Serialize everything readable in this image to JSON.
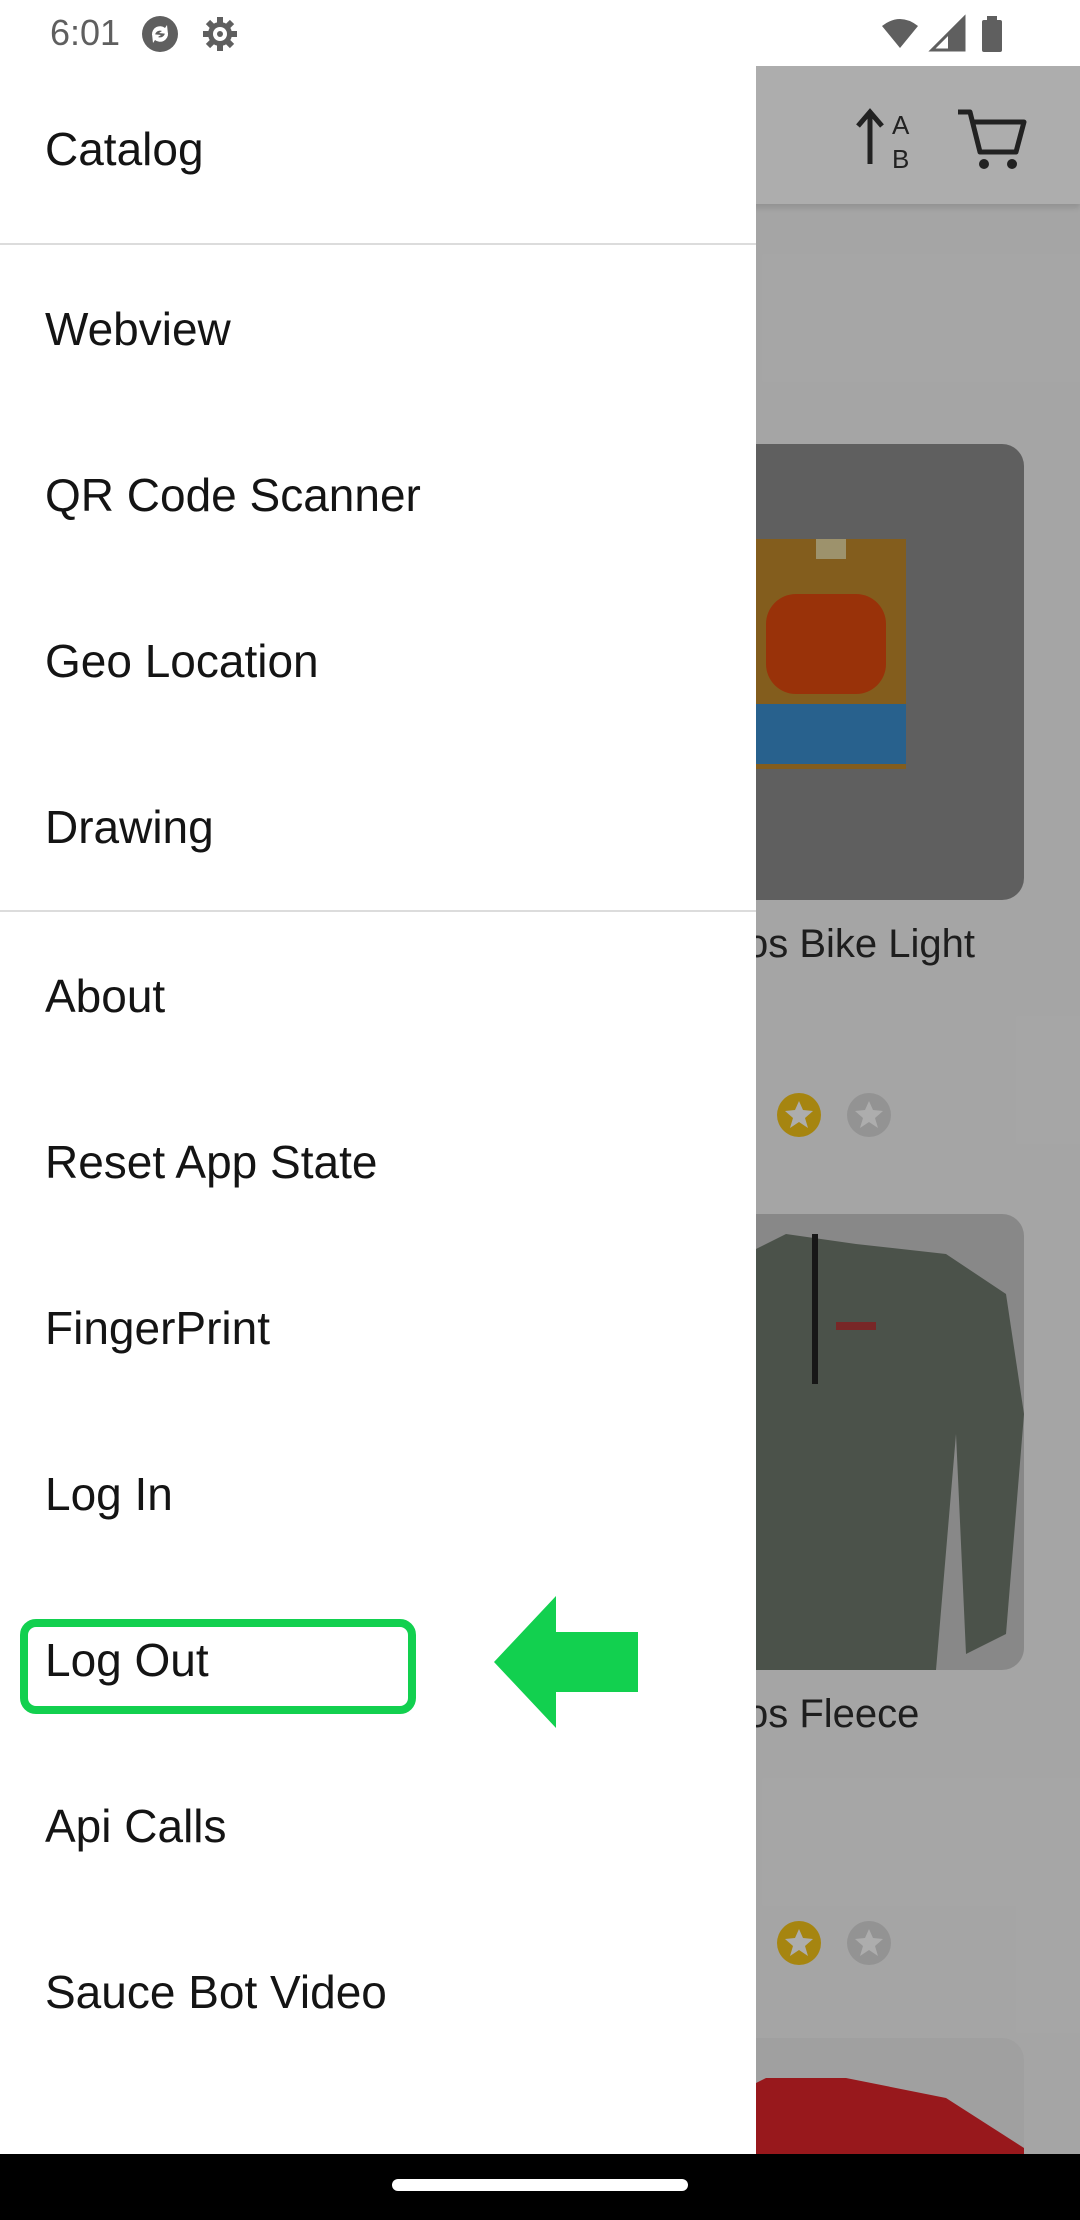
{
  "status_bar": {
    "time": "6:01",
    "left_icons": [
      "sync-icon",
      "settings-icon"
    ],
    "right_icons": [
      "wifi-icon",
      "signal-icon",
      "battery-icon"
    ]
  },
  "background_app": {
    "header_icons": [
      "sort-icon",
      "cart-icon"
    ],
    "products": [
      {
        "name": "Sauce Labs Bike Light",
        "visible_name": "os Bike Light",
        "rating_visible_stars": [
          "filled",
          "empty"
        ]
      },
      {
        "name": "Sauce Labs Fleece",
        "visible_name": "os Fleece",
        "rating_visible_stars": [
          "filled",
          "empty"
        ]
      }
    ],
    "colors": {
      "star_filled": "#f5c518",
      "star_empty": "#d9d9d9"
    }
  },
  "drawer": {
    "groups": [
      {
        "items": [
          {
            "label": "Catalog"
          }
        ]
      },
      {
        "items": [
          {
            "label": "Webview"
          },
          {
            "label": "QR Code Scanner"
          },
          {
            "label": "Geo Location"
          },
          {
            "label": "Drawing"
          }
        ]
      },
      {
        "items": [
          {
            "label": "About"
          },
          {
            "label": "Reset App State"
          },
          {
            "label": "FingerPrint"
          },
          {
            "label": "Log In"
          },
          {
            "label": "Log Out"
          },
          {
            "label": "Api Calls"
          },
          {
            "label": "Sauce Bot Video"
          }
        ]
      }
    ]
  },
  "annotation": {
    "highlighted_item": "Log Out",
    "color": "#12d04f",
    "arrow_direction": "left"
  }
}
